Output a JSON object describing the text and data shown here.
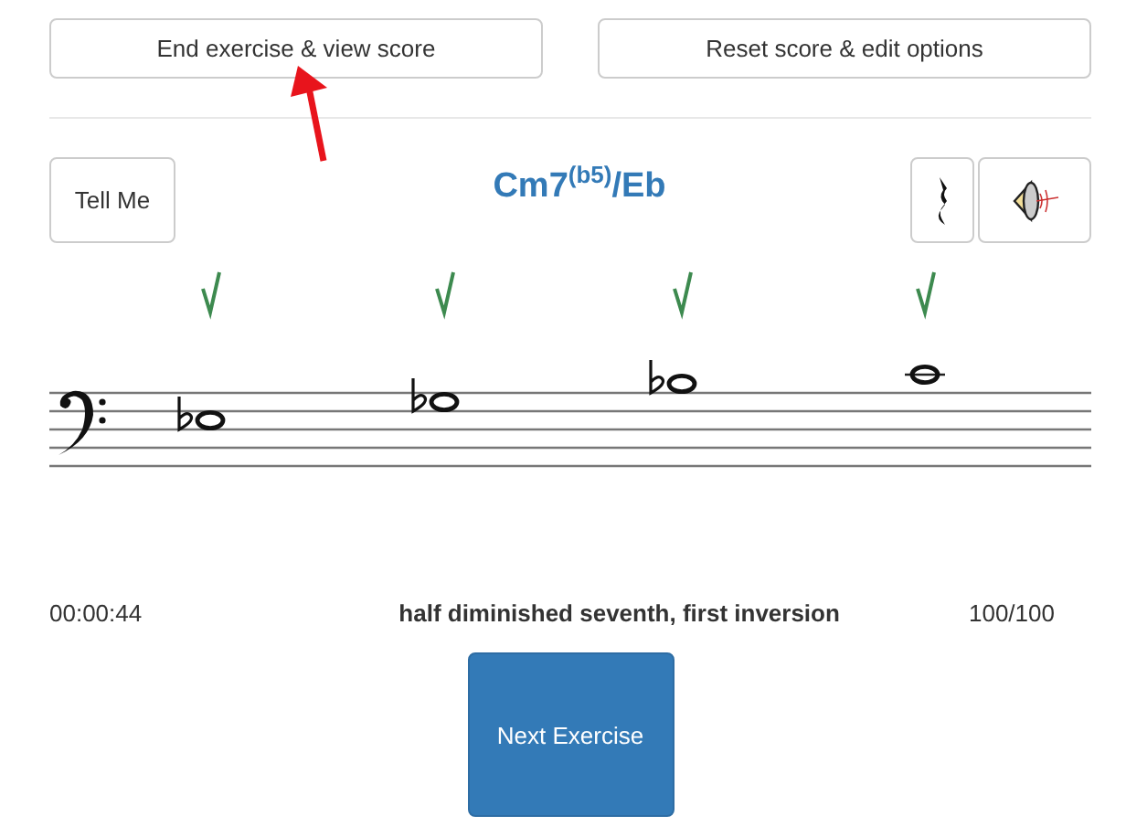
{
  "top_buttons": [
    {
      "label": "End exercise & view score"
    },
    {
      "label": "Reset score & edit options"
    }
  ],
  "tell_me": {
    "label": "Tell Me"
  },
  "chord": {
    "text": "Cm7$^{(b5)}$/Eb"
  },
  "notes": [
    {
      "kind": "flat",
      "correct": true
    },
    {
      "kind": "flat",
      "correct": true
    },
    {
      "kind": "flat",
      "correct": true
    },
    {
      "kind": "plain",
      "correct": true
    }
  ],
  "footer": {
    "time": "00:00:44",
    "chord_name": "half diminished seventh, first inversion",
    "score": "100/100"
  },
  "next_button": {
    "label": "Next Exercise"
  }
}
